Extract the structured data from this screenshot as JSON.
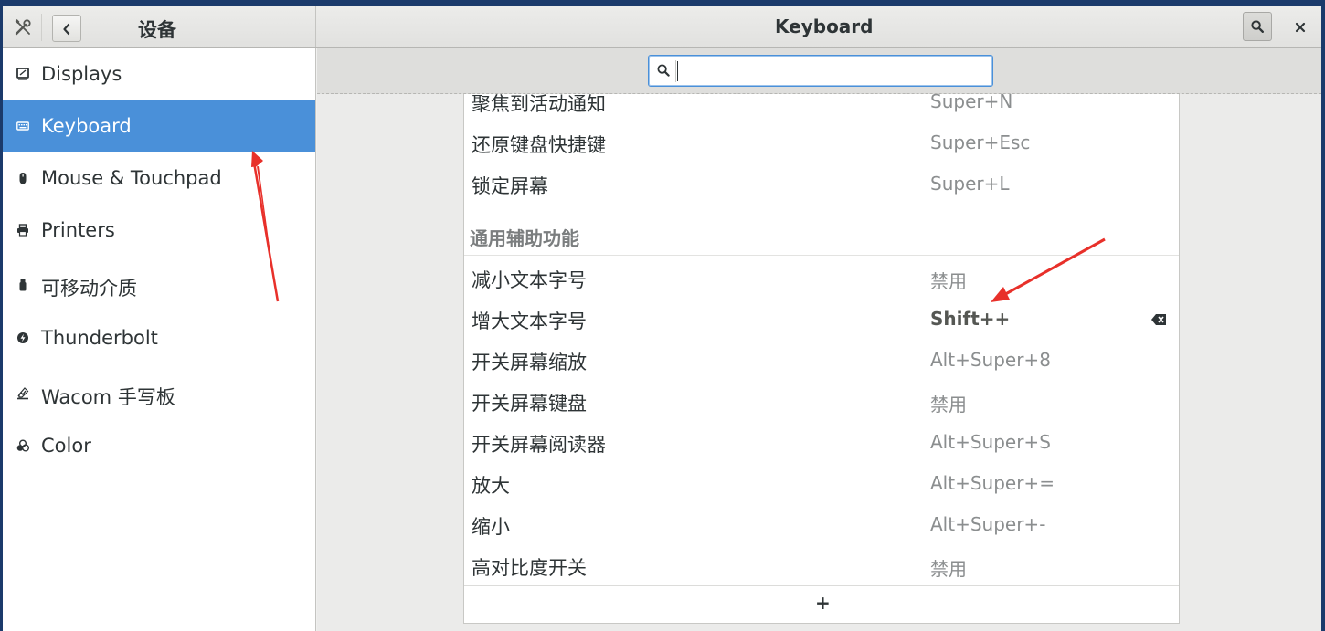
{
  "header": {
    "panel_title": "设备",
    "page_title": "Keyboard",
    "back_icon": "go-previous-icon",
    "search_icon": "search-icon",
    "close_icon": "close-icon",
    "tools_icon": "settings-tools-icon"
  },
  "sidebar": {
    "items": [
      {
        "label": "Displays",
        "icon": "display-icon"
      },
      {
        "label": "Keyboard",
        "icon": "keyboard-icon",
        "selected": true
      },
      {
        "label": "Mouse & Touchpad",
        "icon": "mouse-icon"
      },
      {
        "label": "Printers",
        "icon": "printer-icon"
      },
      {
        "label": "可移动介质",
        "icon": "removable-media-icon"
      },
      {
        "label": "Thunderbolt",
        "icon": "thunderbolt-icon"
      },
      {
        "label": "Wacom 手写板",
        "icon": "tablet-icon"
      },
      {
        "label": "Color",
        "icon": "color-icon"
      }
    ]
  },
  "search": {
    "value": "",
    "placeholder": ""
  },
  "shortcuts": {
    "rows_top": [
      {
        "name": "聚焦到活动通知",
        "accel": "Super+N"
      },
      {
        "name": "还原键盘快捷键",
        "accel": "Super+Esc"
      },
      {
        "name": "锁定屏幕",
        "accel": "Super+L"
      }
    ],
    "section_title": "通用辅助功能",
    "rows": [
      {
        "name": "减小文本字号",
        "accel": "禁用"
      },
      {
        "name": "增大文本字号",
        "accel": "Shift++",
        "modified": true
      },
      {
        "name": "开关屏幕缩放",
        "accel": "Alt+Super+8"
      },
      {
        "name": "开关屏幕键盘",
        "accel": "禁用"
      },
      {
        "name": "开关屏幕阅读器",
        "accel": "Alt+Super+S"
      },
      {
        "name": "放大",
        "accel": "Alt+Super+="
      },
      {
        "name": "缩小",
        "accel": "Alt+Super+-"
      },
      {
        "name": "高对比度开关",
        "accel": "禁用"
      }
    ],
    "add_label": "+",
    "reset_icon": "edit-clear-icon"
  },
  "colors": {
    "accent": "#4a90d9",
    "annotation": "#e8302a"
  }
}
